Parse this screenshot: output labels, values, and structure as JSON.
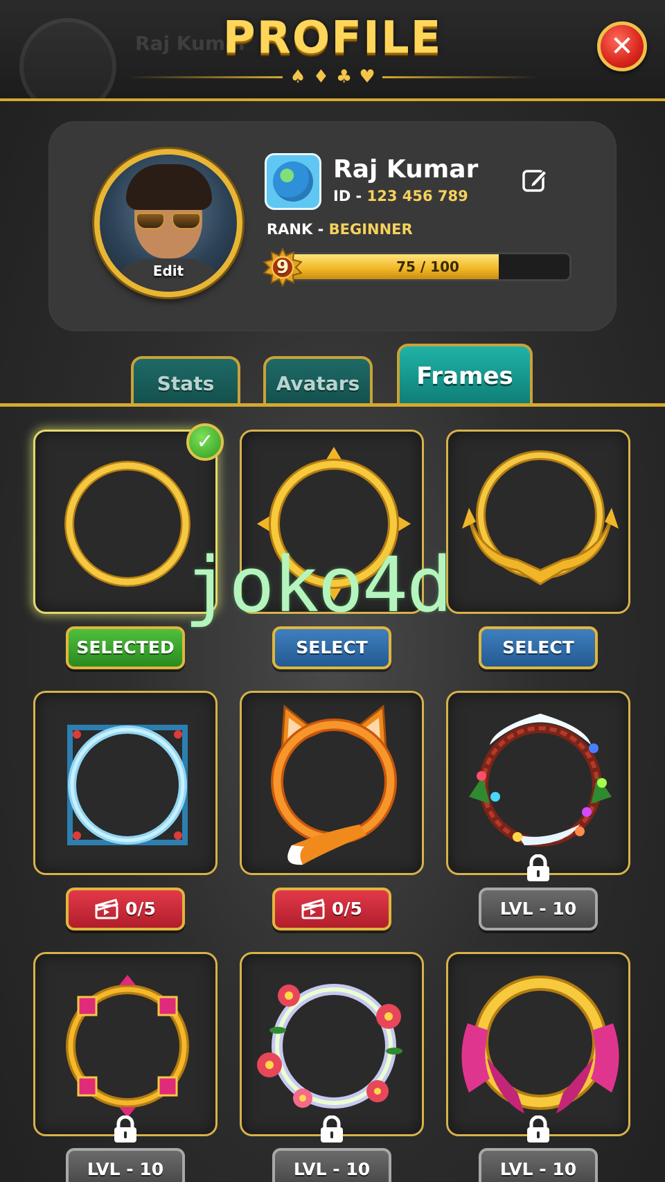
{
  "header": {
    "title": "PROFILE",
    "ghost_name": "Raj Kumar",
    "suits": [
      "♠",
      "♦",
      "♣",
      "♥"
    ]
  },
  "profile": {
    "name": "Raj Kumar",
    "id_label": "ID - ",
    "id_value": "123 456 789",
    "rank_label": "RANK - ",
    "rank_value": "BEGINNER",
    "level": "9",
    "xp_text": "75 / 100",
    "xp_progress": 0.75,
    "avatar_edit_label": "Edit"
  },
  "tabs": [
    {
      "label": "Stats",
      "active": false
    },
    {
      "label": "Avatars",
      "active": false
    },
    {
      "label": "Frames",
      "active": true
    }
  ],
  "frames": [
    {
      "name": "gold-ring",
      "button": "SELECTED",
      "style": "green",
      "selected": true,
      "locked": false
    },
    {
      "name": "sun-spikes",
      "button": "SELECT",
      "style": "blue",
      "selected": false,
      "locked": false
    },
    {
      "name": "royal-crest",
      "button": "SELECT",
      "style": "blue",
      "selected": false,
      "locked": false
    },
    {
      "name": "ice-crystal",
      "button": "0/5",
      "style": "red",
      "selected": false,
      "locked": false,
      "icon": "clapperboard-icon"
    },
    {
      "name": "fox",
      "button": "0/5",
      "style": "red",
      "selected": false,
      "locked": false,
      "icon": "clapperboard-icon"
    },
    {
      "name": "christmas-wreath",
      "button": "LVL - 10",
      "style": "gray",
      "selected": false,
      "locked": true
    },
    {
      "name": "ruby-gold",
      "button": "LVL - 10",
      "style": "gray",
      "selected": false,
      "locked": true
    },
    {
      "name": "floral",
      "button": "LVL - 10",
      "style": "gray",
      "selected": false,
      "locked": true
    },
    {
      "name": "pink-ribbon",
      "button": "LVL - 10",
      "style": "gray",
      "selected": false,
      "locked": true
    }
  ],
  "watermark": "joko4d",
  "colors": {
    "gold": "#d6a92e",
    "teal_active": "#1fb3a8",
    "select_blue": "#235a92",
    "selected_green": "#2a8a20",
    "video_red": "#b11e2b",
    "locked_gray": "#444444"
  }
}
